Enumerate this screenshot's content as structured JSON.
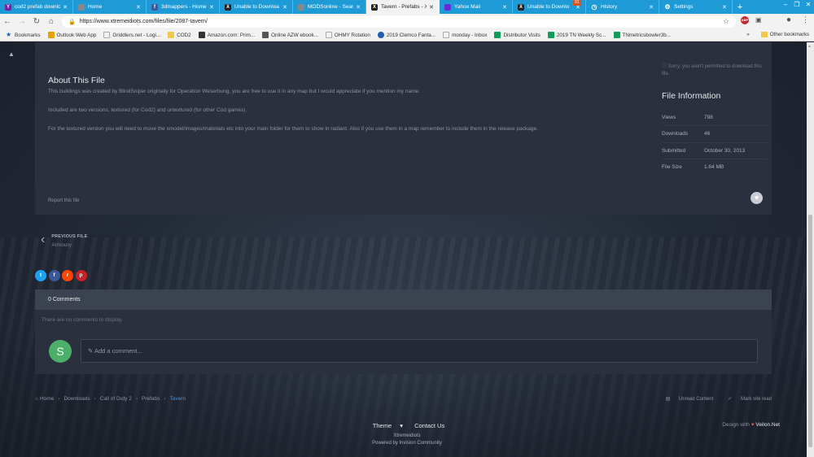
{
  "browser": {
    "tabs": [
      {
        "title": "cod2 prefab downlo",
        "fav": "Y",
        "fav_color": "#7b1fa2",
        "active": false
      },
      {
        "title": "Home",
        "fav": "",
        "fav_color": "#888888",
        "active": false
      },
      {
        "title": "3dmappers - Home",
        "fav": "f",
        "fav_color": "#3b5998",
        "active": false
      },
      {
        "title": "Unable to Downloa",
        "fav": "X",
        "fav_color": "#222222",
        "active": false
      },
      {
        "title": "MODSonline - Searc",
        "fav": "",
        "fav_color": "#888888",
        "active": false
      },
      {
        "title": "Tavern - Prefabs - X",
        "fav": "X",
        "fav_color": "#222222",
        "active": true
      },
      {
        "title": "Yahoo Mail",
        "fav": "",
        "fav_color": "#6d28d9",
        "active": false
      },
      {
        "title": "Unable to Downlo",
        "fav": "X",
        "fav_color": "#222222",
        "active": false
      },
      {
        "title": "History",
        "fav": "◷",
        "fav_color": "#1e9ad6",
        "active": false
      },
      {
        "title": "Settings",
        "fav": "⚙",
        "fav_color": "#1e9ad6",
        "active": false
      }
    ],
    "notification_badge": "91",
    "url": "https://www.xtremeidiots.com/files/file/2087-tavern/",
    "bookmarks": [
      {
        "label": "Bookmarks",
        "color": "#1e5db3"
      },
      {
        "label": "Outlook Web App",
        "color": "#e8a200"
      },
      {
        "label": "Griddlers.net - Logi...",
        "color": "#aaaaaa"
      },
      {
        "label": "COD2",
        "color": "#f2c94c"
      },
      {
        "label": "Amazon.com: Prim...",
        "color": "#333333"
      },
      {
        "label": "Online AZW ebook...",
        "color": "#555555"
      },
      {
        "label": "OHMY Rotation",
        "color": "#aaaaaa"
      },
      {
        "label": "2019 Clemco Fanta...",
        "color": "#1e5db3"
      },
      {
        "label": "monday - Inbox",
        "color": "#aaaaaa"
      },
      {
        "label": "Distributor Visits",
        "color": "#0f9d58"
      },
      {
        "label": "2019 TN Weekly Sc...",
        "color": "#0f9d58"
      },
      {
        "label": "TNmetricsbowler3b...",
        "color": "#0f9d58"
      }
    ],
    "other_bookmarks": "Other bookmarks"
  },
  "file": {
    "about_title": "About This File",
    "description": [
      "This buildings was created by BlindSniper originally for Operation Weserbung, you are free to use it in any map but I would appreciate if you mention my name.",
      "Included are two versions, textured (for Cod2) and untextured (for other Cod games).",
      "For the textured version you will need to move the xmodel/images/materials etc into your main folder for them to show in radiant. Also if you use them in a map remember to include them in the release package."
    ],
    "report": "Report this file",
    "no_permission": "Sorry, you aren't permitted to download this file.",
    "info_title": "File Information",
    "info": [
      {
        "key": "Views",
        "value": "798"
      },
      {
        "key": "Downloads",
        "value": "46"
      },
      {
        "key": "Submitted",
        "value": "October 30, 2013"
      },
      {
        "key": "File Size",
        "value": "1.64 MB"
      }
    ]
  },
  "prev_file": {
    "label": "PREVIOUS FILE",
    "name": "Armoury"
  },
  "comments": {
    "header": "0 Comments",
    "empty": "There are no comments to display.",
    "avatar_letter": "S",
    "placeholder": "Add a comment..."
  },
  "breadcrumb": [
    "Home",
    "Downloads",
    "Call of Duty 2",
    "Prefabs",
    "Tavern"
  ],
  "site_links": {
    "unread": "Unread Content",
    "mark_read": "Mark site read"
  },
  "footer": {
    "theme": "Theme",
    "contact": "Contact Us",
    "site": "Xtremeidiots",
    "powered": "Powered by Invision Community",
    "design_prefix": "Design with",
    "design_brand": "Veilon.Net"
  }
}
